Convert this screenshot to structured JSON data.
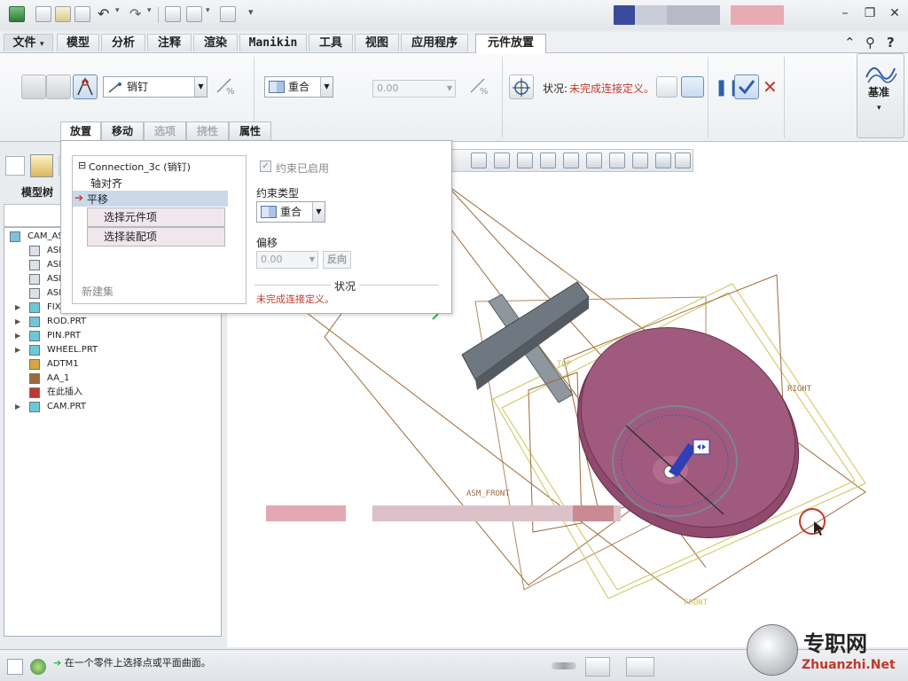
{
  "tabs": {
    "file": "文件",
    "model": "模型",
    "analysis": "分析",
    "annotate": "注释",
    "render": "渲染",
    "manikin": "Manikin",
    "tools": "工具",
    "view": "视图",
    "applications": "应用程序",
    "component_placement": "元件放置"
  },
  "ribbon": {
    "connection_type": "销钉",
    "constraint_type": "重合",
    "offset_value": "0.00",
    "status_label": "状况:",
    "status_text": "未完成连接定义。",
    "datum_label": "基准"
  },
  "subtabs": {
    "placement": "放置",
    "move": "移动",
    "options": "选项",
    "flexibility": "挠性",
    "properties": "属性"
  },
  "panel": {
    "connection_name": "Connection_3c (销钉)",
    "axis_align": "轴对齐",
    "translation": "平移",
    "select_component_item": "选择元件项",
    "select_assembly_item": "选择装配项",
    "new_set": "新建集",
    "constraint_enabled": "约束已启用",
    "constraint_type_label": "约束类型",
    "constraint_type": "重合",
    "offset_label": "偏移",
    "offset_value": "0.00",
    "flip": "反向",
    "status_header": "状况",
    "status_text": "未完成连接定义。"
  },
  "tree": {
    "header": "模型树",
    "items": [
      {
        "label": "CAM_AS",
        "expandable": false
      },
      {
        "label": "ASM",
        "expandable": false
      },
      {
        "label": "ASM",
        "expandable": false
      },
      {
        "label": "ASM",
        "expandable": false
      },
      {
        "label": "ASM",
        "expandable": false
      },
      {
        "label": "FIX",
        "expandable": true
      },
      {
        "label": "ROD.PRT",
        "expandable": true
      },
      {
        "label": "PIN.PRT",
        "expandable": true
      },
      {
        "label": "WHEEL.PRT",
        "expandable": true
      },
      {
        "label": "ADTM1",
        "expandable": false
      },
      {
        "label": "AA_1",
        "expandable": false
      },
      {
        "label": "在此插入",
        "expandable": false
      },
      {
        "label": "CAM.PRT",
        "expandable": true
      }
    ]
  },
  "graphics": {
    "labels": {
      "right": "RIGHT",
      "asm_front": "ASM_FRONT",
      "front": "FRONT",
      "top": "TOP"
    }
  },
  "statusbar": {
    "message": "在一个零件上选择点或平面曲面。"
  },
  "watermark": {
    "title": "专职网",
    "url": "Zhuanzhi.Net"
  },
  "colors": {
    "cam_fill": "#8f4a6e",
    "status_red": "#c0392b",
    "accent_blue": "#2f5fa8",
    "datum_orange": "#9c6a3a",
    "datum_yellow": "#c8c65a"
  }
}
